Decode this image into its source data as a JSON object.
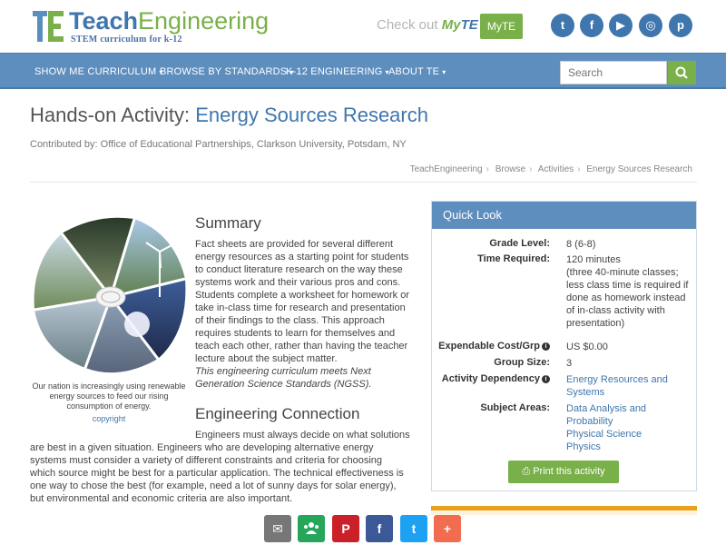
{
  "brand": {
    "logo_mark": "TE",
    "name_first": "Teach",
    "name_second": "Engineering",
    "tagline": "STEM curriculum for k-12",
    "check_out": "Check out ",
    "myte_my": "My",
    "myte_te": "TE",
    "myte_button": "MyTE"
  },
  "social": [
    {
      "name": "twitter-icon",
      "glyph": "t"
    },
    {
      "name": "facebook-icon",
      "glyph": "f"
    },
    {
      "name": "youtube-icon",
      "glyph": "▶"
    },
    {
      "name": "instagram-icon",
      "glyph": "◎"
    },
    {
      "name": "pinterest-icon",
      "glyph": "p"
    }
  ],
  "nav": {
    "items": [
      "SHOW ME CURRICULUM",
      "BROWSE BY STANDARDS",
      "K-12 ENGINEERING",
      "ABOUT TE"
    ],
    "caret": "▾"
  },
  "search": {
    "placeholder": "Search"
  },
  "page": {
    "title_prefix": "Hands-on Activity: ",
    "title_name": "Energy Sources Research",
    "contributed": "Contributed by: Office of Educational Partnerships, Clarkson University, Potsdam, NY"
  },
  "breadcrumbs": [
    "TeachEngineering",
    "Browse",
    "Activities",
    "Energy Sources Research"
  ],
  "image": {
    "caption": "Our nation is increasingly using renewable energy sources to feed our rising consumption of energy.",
    "copyright": "copyright"
  },
  "summary": {
    "heading": "Summary",
    "body": "Fact sheets are provided for several different energy resources as a starting point for students to conduct literature research on the way these systems work and their various pros and cons. Students complete a worksheet for homework or take in-class time for research and presentation of their findings to the class. This approach requires students to learn for themselves and teach each other, rather than having the teacher lecture about the subject matter.",
    "ngss": "This engineering curriculum meets Next Generation Science Standards (NGSS)."
  },
  "engineering": {
    "heading": "Engineering Connection",
    "body_first": "Engineers must always decide on what solutions",
    "body_rest": "are best in a given situation. Engineers who are developing alternative energy systems must consider a variety of different constraints and criteria for choosing which source might be best for a particular application. The technical effectiveness is one way to chose the best (for example, need a lot of sunny days for solar energy), but environmental and economic criteria are also important."
  },
  "quick_look": {
    "heading": "Quick Look",
    "grade_label": "Grade Level:",
    "grade_value": "8 (6-8)",
    "time_label": "Time Required:",
    "time_value": "120 minutes",
    "time_note": "(three 40-minute classes; less class time is required if done as homework instead of in-class activity with presentation)",
    "cost_label": "Expendable Cost/Grp",
    "cost_value": "US $0.00",
    "group_label": "Group Size:",
    "group_value": "3",
    "dependency_label": "Activity Dependency",
    "dependency_value": "Energy Resources and Systems",
    "subject_label": "Subject Areas:",
    "subjects": [
      "Data Analysis and Probability",
      "Physical Science",
      "Physics"
    ],
    "print": "Print this activity"
  },
  "share": [
    {
      "name": "email-share-icon",
      "glyph": "✉",
      "color": "#777777"
    },
    {
      "name": "classroom-share-icon",
      "glyph": "👥",
      "color": "#25a65b"
    },
    {
      "name": "pinterest-share-icon",
      "glyph": "P",
      "color": "#cb2027"
    },
    {
      "name": "facebook-share-icon",
      "glyph": "f",
      "color": "#3b5998"
    },
    {
      "name": "twitter-share-icon",
      "glyph": "t",
      "color": "#1da1f2"
    },
    {
      "name": "more-share-icon",
      "glyph": "+",
      "color": "#f26c4f"
    }
  ],
  "colors": {
    "brand_blue": "#3f76ad",
    "nav_blue": "#5e8ebe",
    "brand_green": "#79b04a",
    "accent_orange": "#e8a21b"
  }
}
